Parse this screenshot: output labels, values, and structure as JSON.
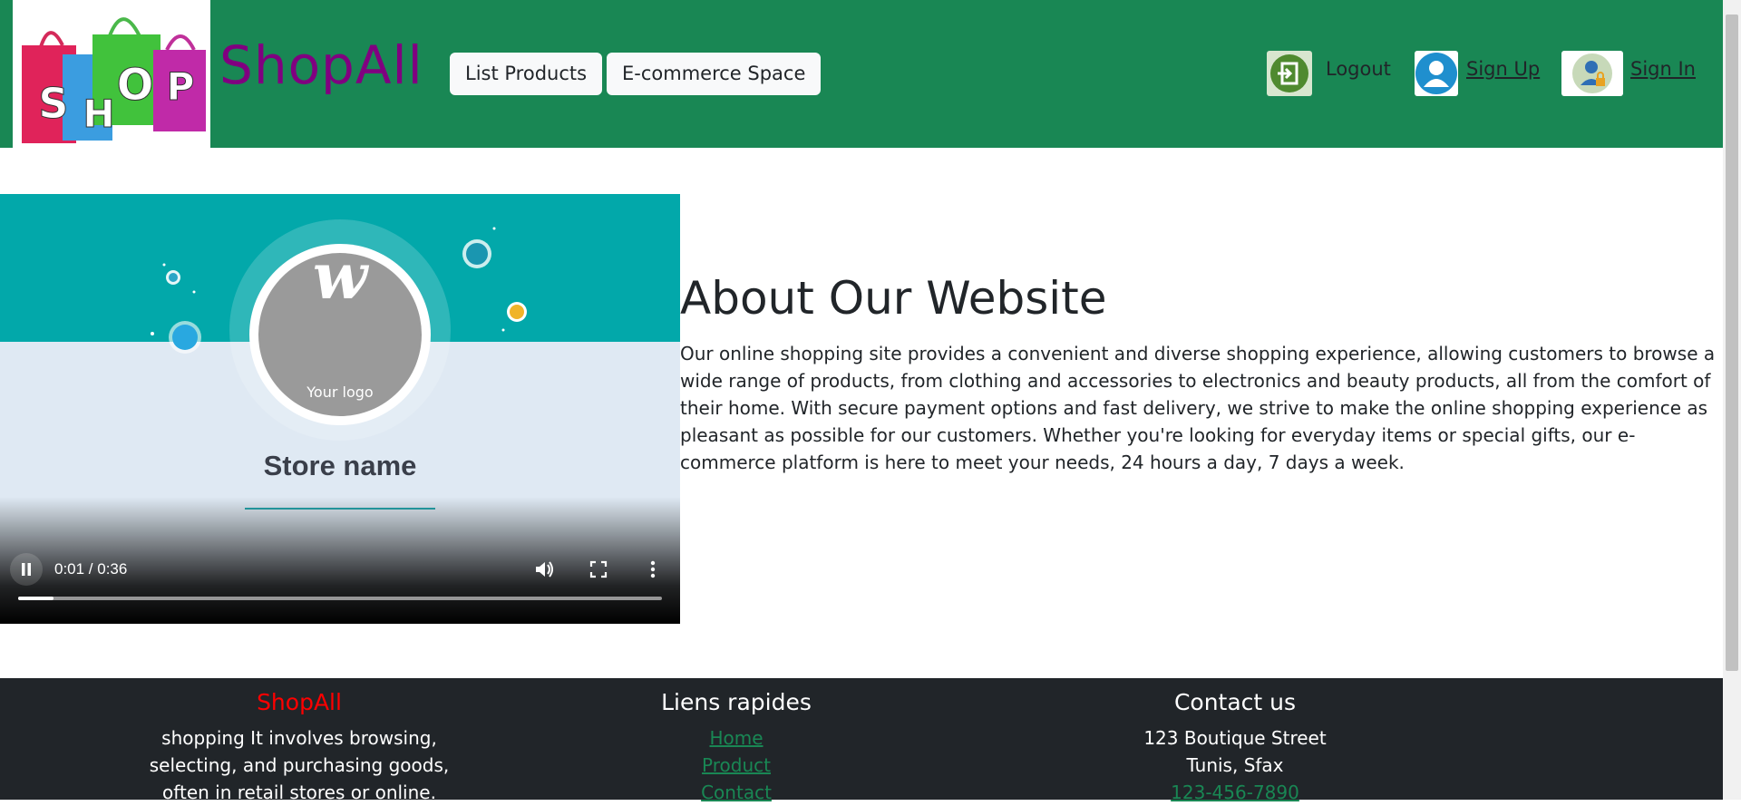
{
  "header": {
    "logo_text": "SHOP",
    "brand": "ShopAll",
    "nav": [
      "List Products",
      "E-commerce Space"
    ],
    "auth": {
      "logout": "Logout",
      "signup": " Sign Up",
      "signin": " Sign In"
    }
  },
  "video": {
    "logo_placeholder": "Your logo",
    "store_name": "Store name",
    "time": "0:01 / 0:36",
    "progress": 0.055,
    "state": "playing"
  },
  "about": {
    "title": "About Our Website",
    "text": "Our online shopping site provides a convenient and diverse shopping experience, allowing customers to browse a wide range of products, from clothing and accessories to electronics and beauty products, all from the comfort of their home. With secure payment options and fast delivery, we strive to make the online shopping experience as pleasant as possible for our customers. Whether you're looking for everyday items or special gifts, our e-commerce platform is here to meet your needs, 24 hours a day, 7 days a week."
  },
  "footer": {
    "brand": {
      "title": "ShopAll",
      "lines": [
        "shopping It involves browsing,",
        "selecting, and purchasing goods,",
        "often in retail stores or online."
      ]
    },
    "quick_links": {
      "title": "Liens rapides",
      "links": [
        "Home",
        "Product",
        "Contact"
      ]
    },
    "contact": {
      "title": "Contact us",
      "address1": "123 Boutique Street",
      "address2": "Tunis, Sfax",
      "phone": "123-456-7890"
    }
  },
  "colors": {
    "header_bg": "#198754",
    "brand": "#800080",
    "footer_bg": "#212529",
    "footer_brand": "#ff0000",
    "link": "#198754",
    "video_teal": "#02a8aa"
  },
  "icons": [
    "logout-icon",
    "signup-user-icon",
    "signin-user-lock-icon",
    "pause-icon",
    "volume-icon",
    "fullscreen-icon",
    "more-options-icon"
  ]
}
